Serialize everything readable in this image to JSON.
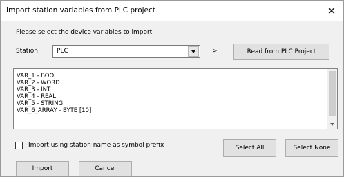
{
  "dialog": {
    "title": "Import station variables from PLC project",
    "close_glyph": "✕",
    "prompt": "Please select the device variables to import",
    "station_label": "Station:",
    "station_value": "PLC",
    "arrow_symbol": ">",
    "read_button": "Read from PLC Project",
    "variables": [
      "VAR_1 - BOOL",
      "VAR_2 - WORD",
      "VAR_3 - INT",
      "VAR_4 - REAL",
      "VAR_5 - STRING",
      "VAR_6_ARRAY - BYTE [10]"
    ],
    "prefix_checkbox_label": "Import using station name as symbol prefix",
    "prefix_checked": false,
    "select_all": "Select All",
    "select_none": "Select None",
    "import": "Import",
    "cancel": "Cancel"
  }
}
